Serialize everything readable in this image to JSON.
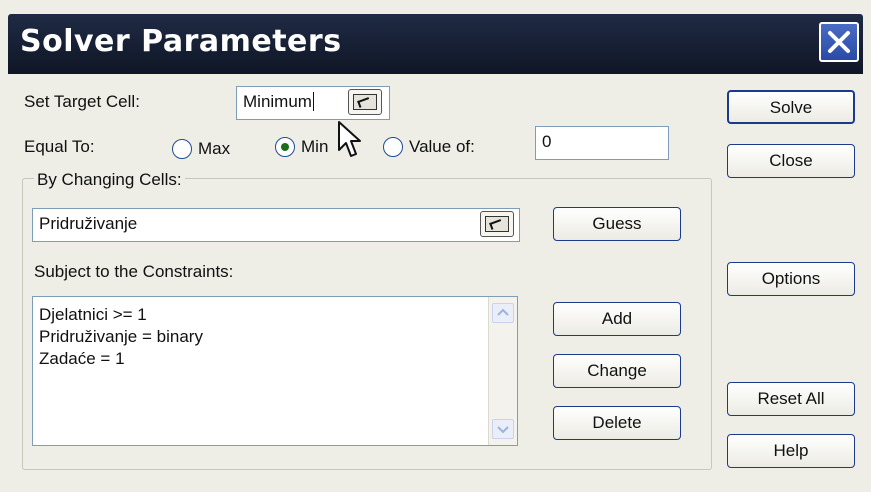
{
  "window": {
    "title": "Solver Parameters"
  },
  "target": {
    "label": "Set Target Cell:",
    "value": "Minimum"
  },
  "equal_to": {
    "label": "Equal To:",
    "options": [
      {
        "label": "Max",
        "checked": false
      },
      {
        "label": "Min",
        "checked": true
      },
      {
        "label": "Value of:",
        "checked": false
      }
    ],
    "value_of": "0"
  },
  "changing": {
    "label": "By Changing Cells:",
    "value": "Pridruživanje",
    "guess_label": "Guess"
  },
  "constraints": {
    "label": "Subject to the Constraints:",
    "items": [
      "Djelatnici >= 1",
      "Pridruživanje = binary",
      "Zadaće = 1"
    ],
    "add_label": "Add",
    "change_label": "Change",
    "delete_label": "Delete"
  },
  "side_buttons": {
    "solve": "Solve",
    "close": "Close",
    "options": "Options",
    "reset_all": "Reset All",
    "help": "Help"
  }
}
